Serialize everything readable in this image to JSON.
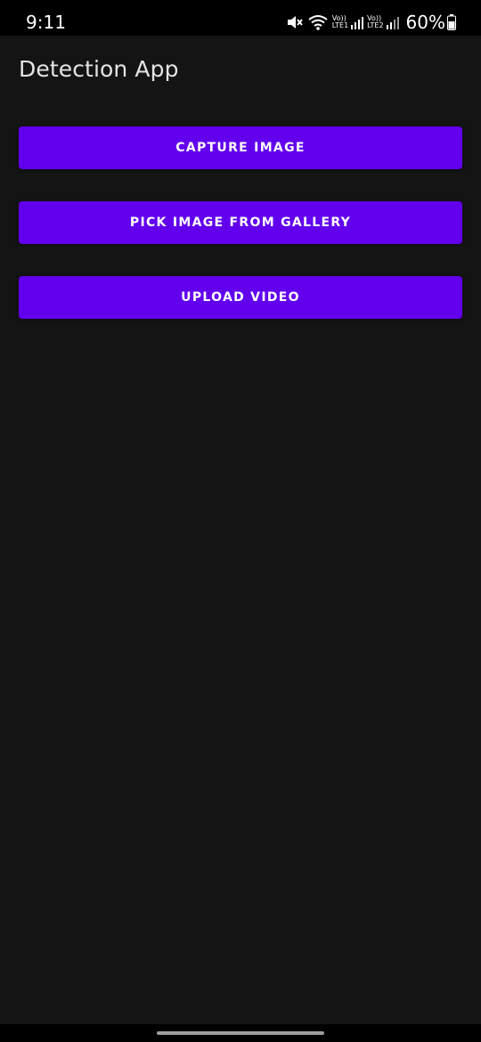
{
  "status_bar": {
    "time": "9:11",
    "sim1_top": "Vo))",
    "sim1_bottom": "LTE1",
    "sim2_top": "Vo))",
    "sim2_bottom": "LTE2",
    "battery_percent": "60%",
    "icons": [
      "mute-icon",
      "wifi-icon",
      "signal-icon",
      "signal-icon",
      "battery-icon"
    ]
  },
  "app_bar": {
    "title": "Detection App"
  },
  "actions": {
    "capture_label": "CAPTURE IMAGE",
    "gallery_label": "PICK IMAGE FROM GALLERY",
    "upload_label": "UPLOAD VIDEO"
  },
  "colors": {
    "background": "#141414",
    "primary": "#6200ee",
    "button_text": "#ffffff",
    "title_text": "#e4e4e4"
  }
}
